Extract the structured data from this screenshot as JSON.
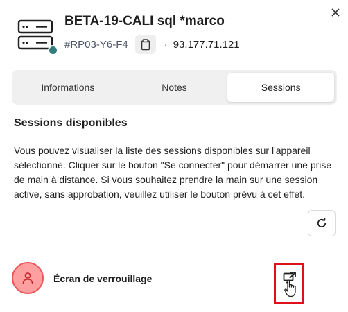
{
  "device": {
    "title": "BETA-19-CALI sql *marco",
    "id": "#RP03-Y6-F4",
    "separator": "·",
    "ip": "93.177.71.121",
    "status_color": "#2f7d7d"
  },
  "icons": {
    "device": "server-icon",
    "close": "close-icon",
    "copy": "clipboard-icon",
    "refresh": "refresh-icon",
    "user": "user-icon",
    "connect": "remote-connect-icon"
  },
  "tabs": [
    {
      "label": "Informations",
      "active": false
    },
    {
      "label": "Notes",
      "active": false
    },
    {
      "label": "Sessions",
      "active": true
    }
  ],
  "sessions": {
    "title": "Sessions disponibles",
    "description": "Vous pouvez visualiser la liste des sessions disponibles sur l'appareil sélectionné. Cliquer sur le bouton \"Se connecter\" pour démarrer une prise de main à distance. Si vous souhaitez prendre la main sur une session active, sans approbation, veuillez utiliser le bouton prévu à cet effet.",
    "items": [
      {
        "name": "Écran de verrouillage",
        "avatar_color": "#ff9fa0",
        "highlight_color": "#e0101b"
      }
    ]
  }
}
